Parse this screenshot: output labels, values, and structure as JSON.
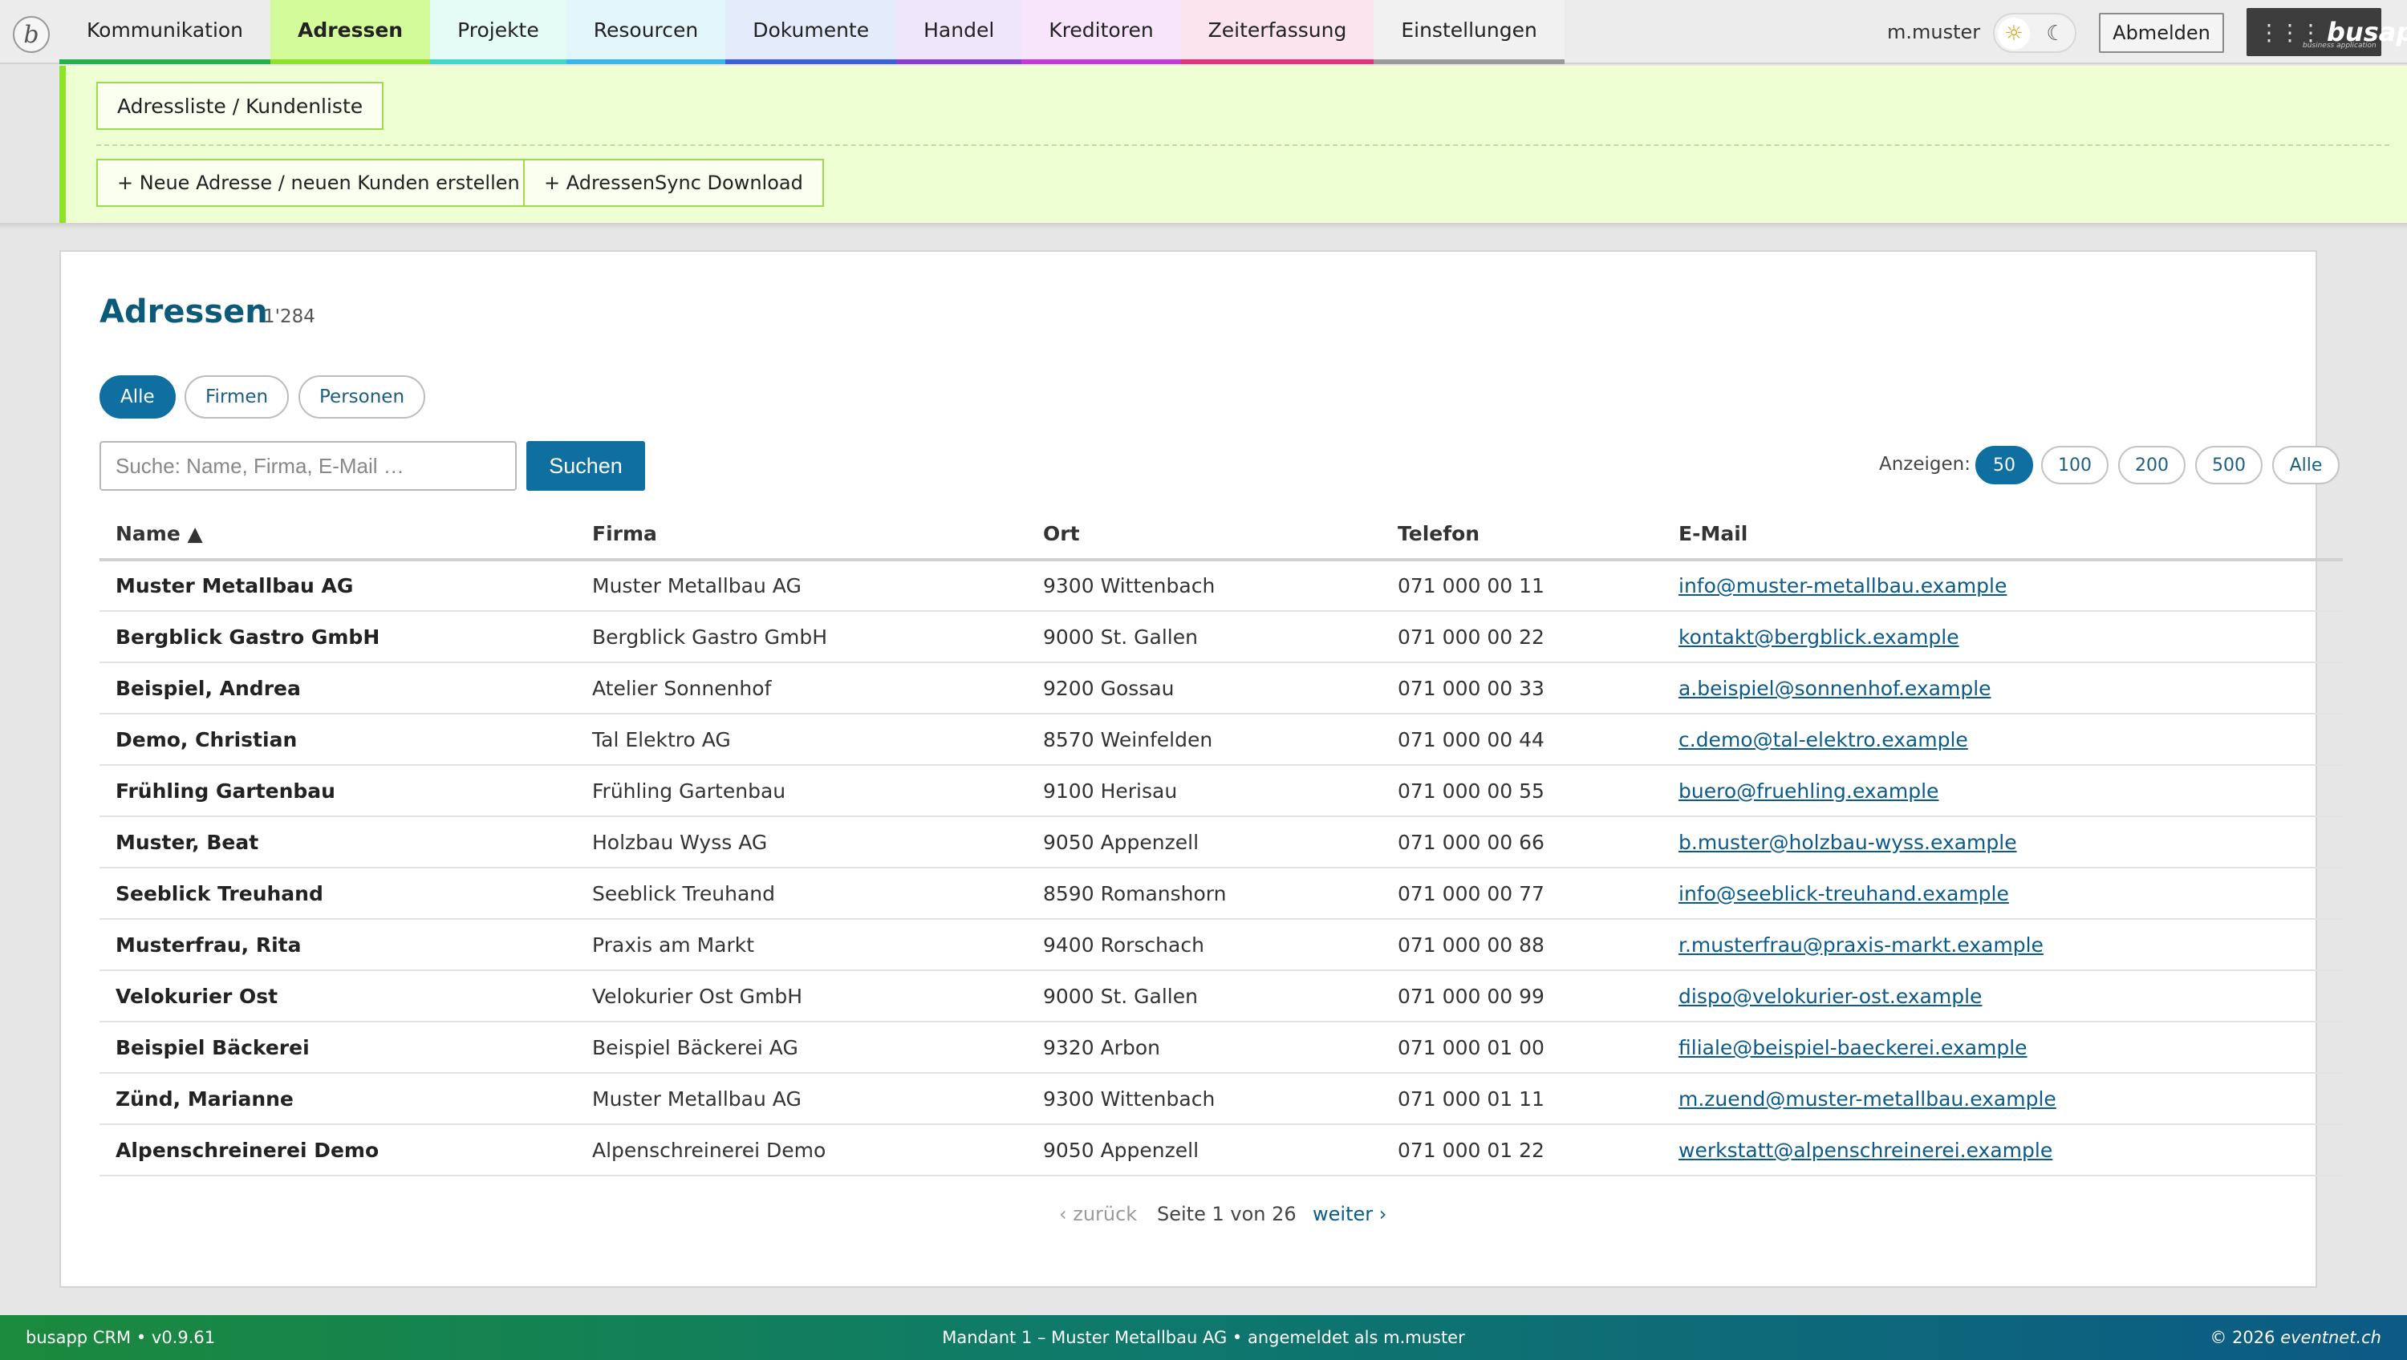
{
  "topnav": {
    "logo_glyph": "b",
    "tabs": [
      {
        "label": "Kommunikation",
        "color": "#22b14c"
      },
      {
        "label": "Adressen",
        "color": "#8ee32a",
        "bg": "#d4fb9a",
        "active": true
      },
      {
        "label": "Projekte",
        "color": "#3fd9c7",
        "bg": "#e4fbf6"
      },
      {
        "label": "Resourcen",
        "color": "#38b6e8",
        "bg": "#e2f5fb"
      },
      {
        "label": "Dokumente",
        "color": "#3a62d8",
        "bg": "#e4ebfb"
      },
      {
        "label": "Handel",
        "color": "#8a3fd0",
        "bg": "#f0e6fb"
      },
      {
        "label": "Kreditoren",
        "color": "#c43ad8",
        "bg": "#f8e4fb"
      },
      {
        "label": "Zeiterfassung",
        "color": "#e3337a",
        "bg": "#fbe4ee"
      },
      {
        "label": "Einstellungen",
        "color": "#9a9a9a",
        "bg": "#f1f1f1"
      }
    ],
    "user": "m.muster",
    "logout_label": "Abmelden",
    "brand_name": "busapp",
    "brand_sub": "business application"
  },
  "subnav": {
    "crumb_label": "Adressliste / Kundenliste",
    "actions": [
      {
        "label": "+ Neue Adresse / neuen Kunden erstellen"
      },
      {
        "label": "+ AdressenSync Download"
      }
    ]
  },
  "main": {
    "title": "Adressen",
    "count": "1'284",
    "filters": [
      {
        "label": "Alle",
        "active": true
      },
      {
        "label": "Firmen",
        "active": false
      },
      {
        "label": "Personen",
        "active": false
      }
    ],
    "search_placeholder": "Suche: Name, Firma, E-Mail …",
    "search_label": "Suchen",
    "show_label": "Anzeigen:",
    "page_sizes": [
      {
        "label": "50",
        "active": true
      },
      {
        "label": "100",
        "active": false
      },
      {
        "label": "200",
        "active": false
      },
      {
        "label": "500",
        "active": false
      },
      {
        "label": "Alle",
        "active": false
      }
    ]
  },
  "table": {
    "columns": [
      "Name ▲",
      "Firma",
      "Ort",
      "Telefon",
      "E-Mail"
    ],
    "rows": [
      [
        "Muster Metallbau AG",
        "Muster Metallbau AG",
        "9300 Wittenbach",
        "071 000 00 11",
        "info@muster-metallbau.example"
      ],
      [
        "Bergblick Gastro GmbH",
        "Bergblick Gastro GmbH",
        "9000 St. Gallen",
        "071 000 00 22",
        "kontakt@bergblick.example"
      ],
      [
        "Beispiel, Andrea",
        "Atelier Sonnenhof",
        "9200 Gossau",
        "071 000 00 33",
        "a.beispiel@sonnenhof.example"
      ],
      [
        "Demo, Christian",
        "Tal Elektro AG",
        "8570 Weinfelden",
        "071 000 00 44",
        "c.demo@tal-elektro.example"
      ],
      [
        "Frühling Gartenbau",
        "Frühling Gartenbau",
        "9100 Herisau",
        "071 000 00 55",
        "buero@fruehling.example"
      ],
      [
        "Muster, Beat",
        "Holzbau Wyss AG",
        "9050 Appenzell",
        "071 000 00 66",
        "b.muster@holzbau-wyss.example"
      ],
      [
        "Seeblick Treuhand",
        "Seeblick Treuhand",
        "8590 Romanshorn",
        "071 000 00 77",
        "info@seeblick-treuhand.example"
      ],
      [
        "Musterfrau, Rita",
        "Praxis am Markt",
        "9400 Rorschach",
        "071 000 00 88",
        "r.musterfrau@praxis-markt.example"
      ],
      [
        "Velokurier Ost",
        "Velokurier Ost GmbH",
        "9000 St. Gallen",
        "071 000 00 99",
        "dispo@velokurier-ost.example"
      ],
      [
        "Beispiel Bäckerei",
        "Beispiel Bäckerei AG",
        "9320 Arbon",
        "071 000 01 00",
        "filiale@beispiel-baeckerei.example"
      ],
      [
        "Zünd, Marianne",
        "Muster Metallbau AG",
        "9300 Wittenbach",
        "071 000 01 11",
        "m.zuend@muster-metallbau.example"
      ],
      [
        "Alpenschreinerei Demo",
        "Alpenschreinerei Demo",
        "9050 Appenzell",
        "071 000 01 22",
        "werkstatt@alpenschreinerei.example"
      ]
    ]
  },
  "pager": {
    "prev": "‹ zurück",
    "info": "Seite 1 von 26",
    "next": "weiter ›"
  },
  "footer": {
    "left": "busapp CRM • v0.9.61",
    "center": "Mandant 1 – Muster Metallbau AG • angemeldet als m.muster",
    "right_prefix": "© 2026 ",
    "right_brand": "eventnet.ch"
  },
  "colors": {
    "accent": "#0e6fa0",
    "title": "#0b5a7a",
    "subnav_bg": "#efffd4",
    "subnav_border": "#8ee32a"
  }
}
